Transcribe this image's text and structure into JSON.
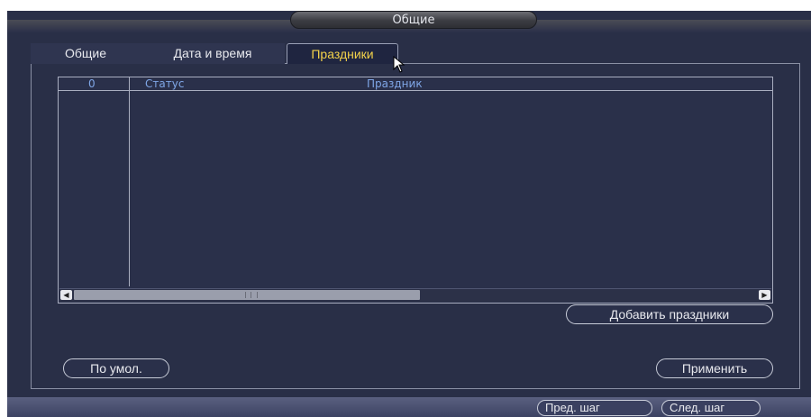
{
  "window": {
    "title": "Общие"
  },
  "tabs": [
    {
      "label": "Общие",
      "active": false
    },
    {
      "label": "Дата и время",
      "active": false
    },
    {
      "label": "Праздники",
      "active": true
    }
  ],
  "table": {
    "columns": {
      "index": "0",
      "status": "Статус",
      "holiday": "Праздник"
    },
    "rows": [],
    "scroll_position": 0.5
  },
  "buttons": {
    "add": "Добавить праздники",
    "default": "По умол.",
    "apply": "Применить"
  },
  "footer": {
    "prev": "Пред. шаг",
    "next": "След. шаг"
  },
  "colors": {
    "background": "#292f47",
    "active_tab_text": "#f3d24a",
    "table_header_text": "#7fa6e6"
  },
  "icons": {
    "cursor": "mouse-pointer-icon",
    "scroll_left": "arrow-left-icon",
    "scroll_right": "arrow-right-icon"
  }
}
